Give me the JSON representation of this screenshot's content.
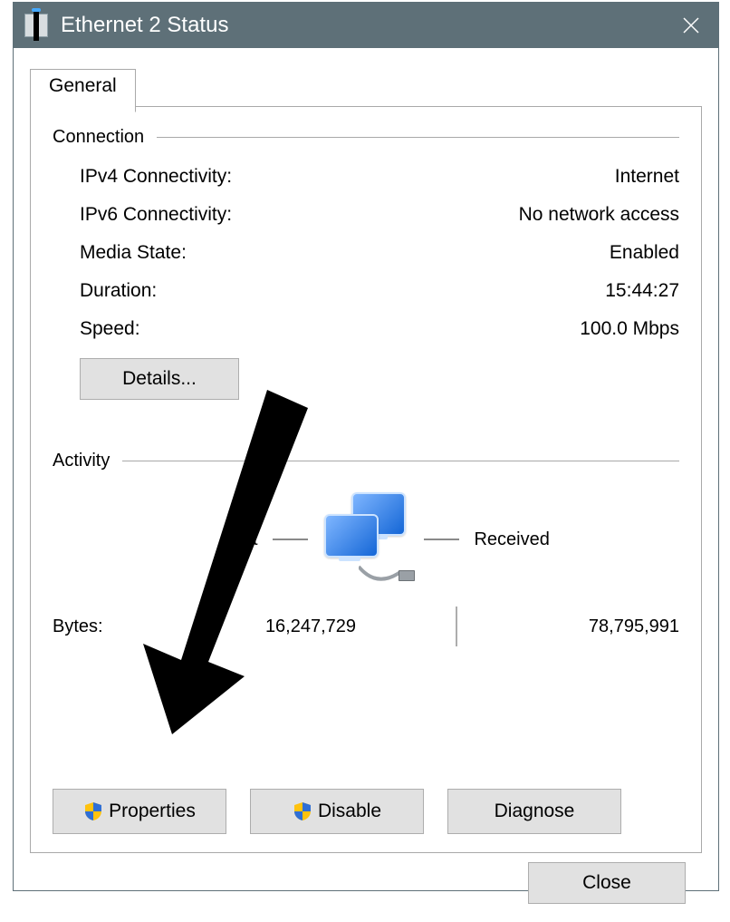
{
  "window": {
    "title": "Ethernet 2 Status"
  },
  "tab": {
    "general": "General"
  },
  "connection": {
    "heading": "Connection",
    "ipv4_label": "IPv4 Connectivity:",
    "ipv4_value": "Internet",
    "ipv6_label": "IPv6 Connectivity:",
    "ipv6_value": "No network access",
    "media_label": "Media State:",
    "media_value": "Enabled",
    "duration_label": "Duration:",
    "duration_value": "15:44:27",
    "speed_label": "Speed:",
    "speed_value": "100.0 Mbps",
    "details_button": "Details..."
  },
  "activity": {
    "heading": "Activity",
    "sent_label": "Sent",
    "received_label": "Received",
    "bytes_label": "Bytes:",
    "bytes_sent": "16,247,729",
    "bytes_received": "78,795,991"
  },
  "buttons": {
    "properties": "Properties",
    "disable": "Disable",
    "diagnose": "Diagnose",
    "close": "Close"
  }
}
